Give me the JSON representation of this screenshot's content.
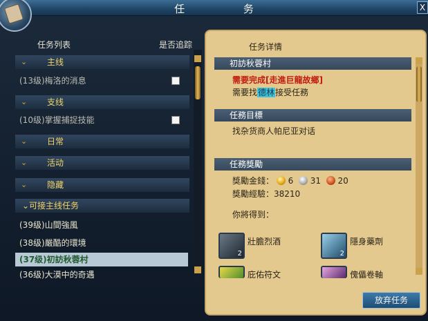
{
  "window": {
    "title": "任 务",
    "close_label": "X"
  },
  "left": {
    "header_list": "任务列表",
    "header_track": "是否追踪",
    "categories": [
      {
        "label": "主线",
        "arrow": "⌄"
      },
      {
        "label": "支线",
        "arrow": "⌄"
      },
      {
        "label": "日常",
        "arrow": "⌄"
      },
      {
        "label": "活动",
        "arrow": "⌄"
      },
      {
        "label": "隐藏",
        "arrow": "⌄"
      }
    ],
    "main_items": [
      {
        "label": "(13级)梅洛的消息",
        "tracked": false
      }
    ],
    "side_items": [
      {
        "label": "(10级)掌握捕捉技能",
        "tracked": false
      }
    ],
    "available_header": "⌄可接主线任务",
    "available": [
      {
        "label": "(39级)山間強風"
      },
      {
        "label": "(38级)嚴酷的環境"
      },
      {
        "label": "(37级)初訪秋蓉村",
        "selected": true
      },
      {
        "label": "(36级)大漠中的奇遇"
      }
    ]
  },
  "right": {
    "header": "任务详情",
    "quest_title": "初訪秋蓉村",
    "requirement": "需要完成[走進巨龍故鄉]",
    "accept_prefix": "需要找",
    "accept_name": "德林",
    "accept_suffix": "接受任務",
    "goal_title": "任務目標",
    "goal_text": "找杂货商人帕尼亚对话",
    "reward_title": "任務獎勵",
    "reward_money_label": "獎勵金錢：",
    "gold": "6",
    "silver": "31",
    "copper": "20",
    "reward_exp_label": "獎勵經驗：",
    "reward_exp_value": "38210",
    "you_get": "你將得到：",
    "rewards": [
      {
        "label": "壯膽烈酒",
        "count": "2",
        "icon": "wine-icon"
      },
      {
        "label": "隱身藥劑",
        "count": "2",
        "icon": "potion-icon"
      },
      {
        "label": "庇佑符文",
        "count": "",
        "icon": "rune-icon"
      },
      {
        "label": "傀儡卷軸",
        "count": "",
        "icon": "scroll-icon"
      }
    ]
  },
  "buttons": {
    "abandon": "放弃任务"
  }
}
